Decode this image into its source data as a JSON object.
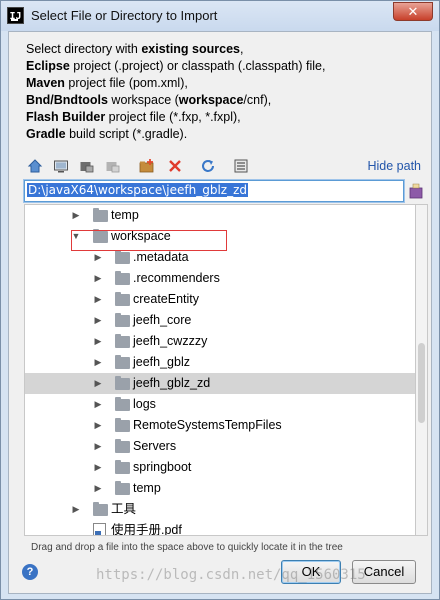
{
  "window": {
    "title": "Select File or Directory to Import",
    "app_icon": "IJ",
    "close_glyph": "✕"
  },
  "description": [
    [
      {
        "t": "Select directory with ",
        "b": false
      },
      {
        "t": "existing sources",
        "b": true
      },
      {
        "t": ",",
        "b": false
      }
    ],
    [
      {
        "t": "Eclipse",
        "b": true
      },
      {
        "t": " project (.project) or classpath (.classpath) file,",
        "b": false
      }
    ],
    [
      {
        "t": "Maven",
        "b": true
      },
      {
        "t": " project file (pom.xml),",
        "b": false
      }
    ],
    [
      {
        "t": "Bnd/Bndtools",
        "b": true
      },
      {
        "t": " workspace (",
        "b": false
      },
      {
        "t": "workspace",
        "b": true
      },
      {
        "t": "/cnf),",
        "b": false
      }
    ],
    [
      {
        "t": "Flash Builder",
        "b": true
      },
      {
        "t": " project file (*.fxp, *.fxpl),",
        "b": false
      }
    ],
    [
      {
        "t": "Gradle",
        "b": true
      },
      {
        "t": " build script (*.gradle).",
        "b": false
      }
    ]
  ],
  "toolbar": {
    "icons": [
      "home-icon",
      "desktop-icon",
      "project-icon",
      "module-icon",
      "new-folder-icon",
      "delete-icon",
      "refresh-icon",
      "show-hidden-icon"
    ],
    "hide_path": "Hide path"
  },
  "path": {
    "value": "D:\\javaX64\\workspace\\jeefh_gblz_zd"
  },
  "tree": [
    {
      "label": "temp",
      "depth": 0,
      "expanded": false,
      "type": "folder"
    },
    {
      "label": "workspace",
      "depth": 0,
      "expanded": true,
      "type": "folder"
    },
    {
      "label": ".metadata",
      "depth": 1,
      "expanded": false,
      "type": "folder"
    },
    {
      "label": ".recommenders",
      "depth": 1,
      "expanded": false,
      "type": "folder"
    },
    {
      "label": "createEntity",
      "depth": 1,
      "expanded": false,
      "type": "folder"
    },
    {
      "label": "jeefh_core",
      "depth": 1,
      "expanded": false,
      "type": "folder"
    },
    {
      "label": "jeefh_cwzzzy",
      "depth": 1,
      "expanded": false,
      "type": "folder"
    },
    {
      "label": "jeefh_gblz",
      "depth": 1,
      "expanded": false,
      "type": "folder"
    },
    {
      "label": "jeefh_gblz_zd",
      "depth": 1,
      "expanded": false,
      "type": "folder",
      "selected": true
    },
    {
      "label": "logs",
      "depth": 1,
      "expanded": false,
      "type": "folder"
    },
    {
      "label": "RemoteSystemsTempFiles",
      "depth": 1,
      "expanded": false,
      "type": "folder"
    },
    {
      "label": "Servers",
      "depth": 1,
      "expanded": false,
      "type": "folder"
    },
    {
      "label": "springboot",
      "depth": 1,
      "expanded": false,
      "type": "folder"
    },
    {
      "label": "temp",
      "depth": 1,
      "expanded": false,
      "type": "folder"
    },
    {
      "label": "工具",
      "depth": 0,
      "expanded": false,
      "type": "folder"
    },
    {
      "label": "使用手册.pdf",
      "depth": 0,
      "expanded": null,
      "type": "file"
    }
  ],
  "hint": "Drag and drop a file into the space above to quickly locate it in the tree",
  "buttons": {
    "help": "?",
    "ok": "OK",
    "cancel": "Cancel"
  },
  "watermark": "https://blog.csdn.net/qq_1560315"
}
